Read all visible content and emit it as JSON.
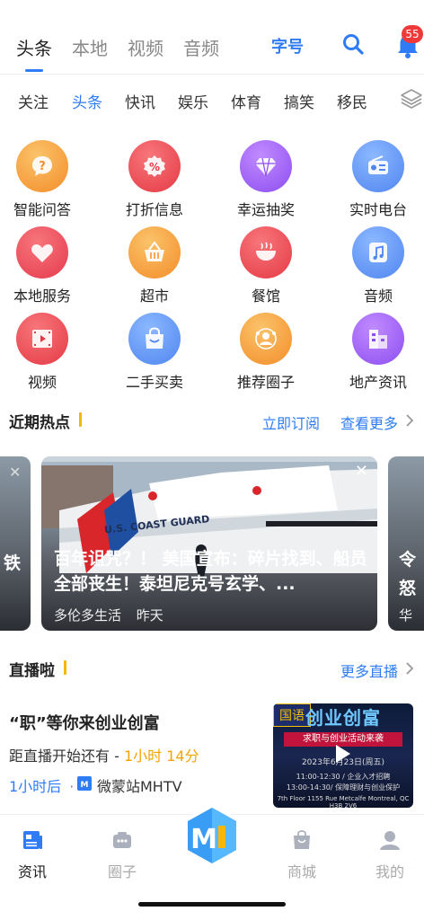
{
  "top_tabs": [
    {
      "label": "头条",
      "active": true
    },
    {
      "label": "本地",
      "active": false
    },
    {
      "label": "视频",
      "active": false
    },
    {
      "label": "音频",
      "active": false
    }
  ],
  "header": {
    "font_size_label": "字号",
    "notification_count": "55",
    "accent_color": "#2f7cf6",
    "icons": [
      "search-icon",
      "bell-icon"
    ]
  },
  "categories": [
    {
      "label": "关注",
      "active": false
    },
    {
      "label": "头条",
      "active": true
    },
    {
      "label": "快讯",
      "active": false
    },
    {
      "label": "娱乐",
      "active": false
    },
    {
      "label": "体育",
      "active": false
    },
    {
      "label": "搞笑",
      "active": false
    },
    {
      "label": "移民",
      "active": false
    }
  ],
  "services": [
    {
      "label": "智能问答",
      "icon": "question-chat-icon",
      "color": "#f7a23a"
    },
    {
      "label": "打折信息",
      "icon": "percent-icon",
      "color": "#ef4b52"
    },
    {
      "label": "幸运抽奖",
      "icon": "diamond-icon",
      "color": "#9a5cf0"
    },
    {
      "label": "实时电台",
      "icon": "radio-icon",
      "color": "#5a95f5"
    },
    {
      "label": "本地服务",
      "icon": "heart-icon",
      "color": "#ef4b5a"
    },
    {
      "label": "超市",
      "icon": "basket-icon",
      "color": "#f7a23a"
    },
    {
      "label": "餐馆",
      "icon": "bowl-icon",
      "color": "#ef4b52"
    },
    {
      "label": "音频",
      "icon": "music-note-icon",
      "color": "#5a95f5"
    },
    {
      "label": "视频",
      "icon": "film-icon",
      "color": "#ef4b52"
    },
    {
      "label": "二手买卖",
      "icon": "shopping-bag-icon",
      "color": "#5a95f5"
    },
    {
      "label": "推荐圈子",
      "icon": "people-icon",
      "color": "#f7a23a"
    },
    {
      "label": "地产资讯",
      "icon": "building-icon",
      "color": "#9a5cf0"
    }
  ],
  "hot": {
    "title": "近期热点",
    "subscribe_label": "立即订阅",
    "more_label": "查看更多",
    "card": {
      "title": "百年诅咒？！ 美国宣布：碎片找到、船员全部丧生！泰坦尼克号玄学、...",
      "source": "多伦多生活",
      "time": "昨天",
      "ship_text": "U.S. COAST GUARD"
    },
    "left_card_char": "铁",
    "right_card_chars": [
      "令",
      "怒",
      "华"
    ]
  },
  "live": {
    "title": "直播啦",
    "more_label": "更多直播",
    "item": {
      "title": "“职”等你来创业创富",
      "countdown_prefix": "距直播开始还有 -",
      "countdown_value": "1小时 14分",
      "relative_time": "1小时后",
      "separator": "·",
      "station": "微蒙站MHTV",
      "thumb": {
        "lang_tag": "国语",
        "headline": "创业创富",
        "banner": "求职与创业活动来袭",
        "date": "2023年6月23日(周五)",
        "line1": "11:00-12:30 / 企业入才招聘",
        "line2": "13:00-14:30/ 保障理财与创业保护",
        "address": "7th Floor 1155 Rue Metcalfe Montreal, QC H3B 2V6"
      }
    }
  },
  "bottom_nav": [
    {
      "label": "资讯",
      "icon": "news-icon",
      "active": true
    },
    {
      "label": "圈子",
      "icon": "group-icon",
      "active": false
    },
    {
      "label": "",
      "icon": "m-logo-icon",
      "active": false
    },
    {
      "label": "商城",
      "icon": "shop-bag-icon",
      "active": false
    },
    {
      "label": "我的",
      "icon": "profile-icon",
      "active": false
    }
  ]
}
